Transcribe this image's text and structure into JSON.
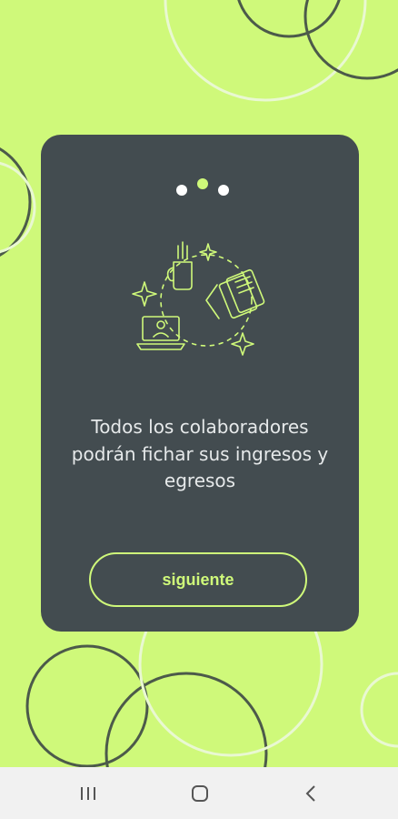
{
  "onboarding": {
    "message": "Todos los colaboradores podrán fichar sus ingresos y egresos",
    "next_label": "siguiente",
    "step_current": 2,
    "step_total": 3
  },
  "icons": {
    "illustration": "remote-work-illustration",
    "recents": "recents-icon",
    "home": "home-icon",
    "back": "back-icon"
  },
  "colors": {
    "background": "#cff97a",
    "card": "#434c50",
    "accent": "#cff97a"
  }
}
